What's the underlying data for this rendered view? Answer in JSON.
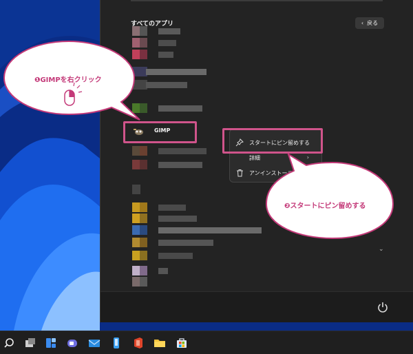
{
  "start_menu": {
    "section_title": "すべてのアプリ",
    "back_label": "戻る",
    "gimp_label": "GIMP"
  },
  "context_menu": {
    "items": [
      {
        "label": "スタートにピン留めする",
        "icon": "pin-icon"
      },
      {
        "label": "詳細",
        "icon": "more-icon"
      },
      {
        "label": "アンインストール",
        "icon": "trash-icon"
      }
    ]
  },
  "callouts": {
    "step1": "❶GIMPを右クリック",
    "step2": "❷スタートにピン留めする"
  },
  "colors": {
    "accent": "#d0548b",
    "menu_bg": "#232323",
    "callout_text": "#c43a79"
  },
  "taskbar": {
    "icons": [
      "search-icon",
      "task-view-icon",
      "widgets-icon",
      "teams-icon",
      "mail-icon",
      "phone-link-icon",
      "office-icon",
      "file-explorer-icon",
      "store-icon"
    ]
  }
}
